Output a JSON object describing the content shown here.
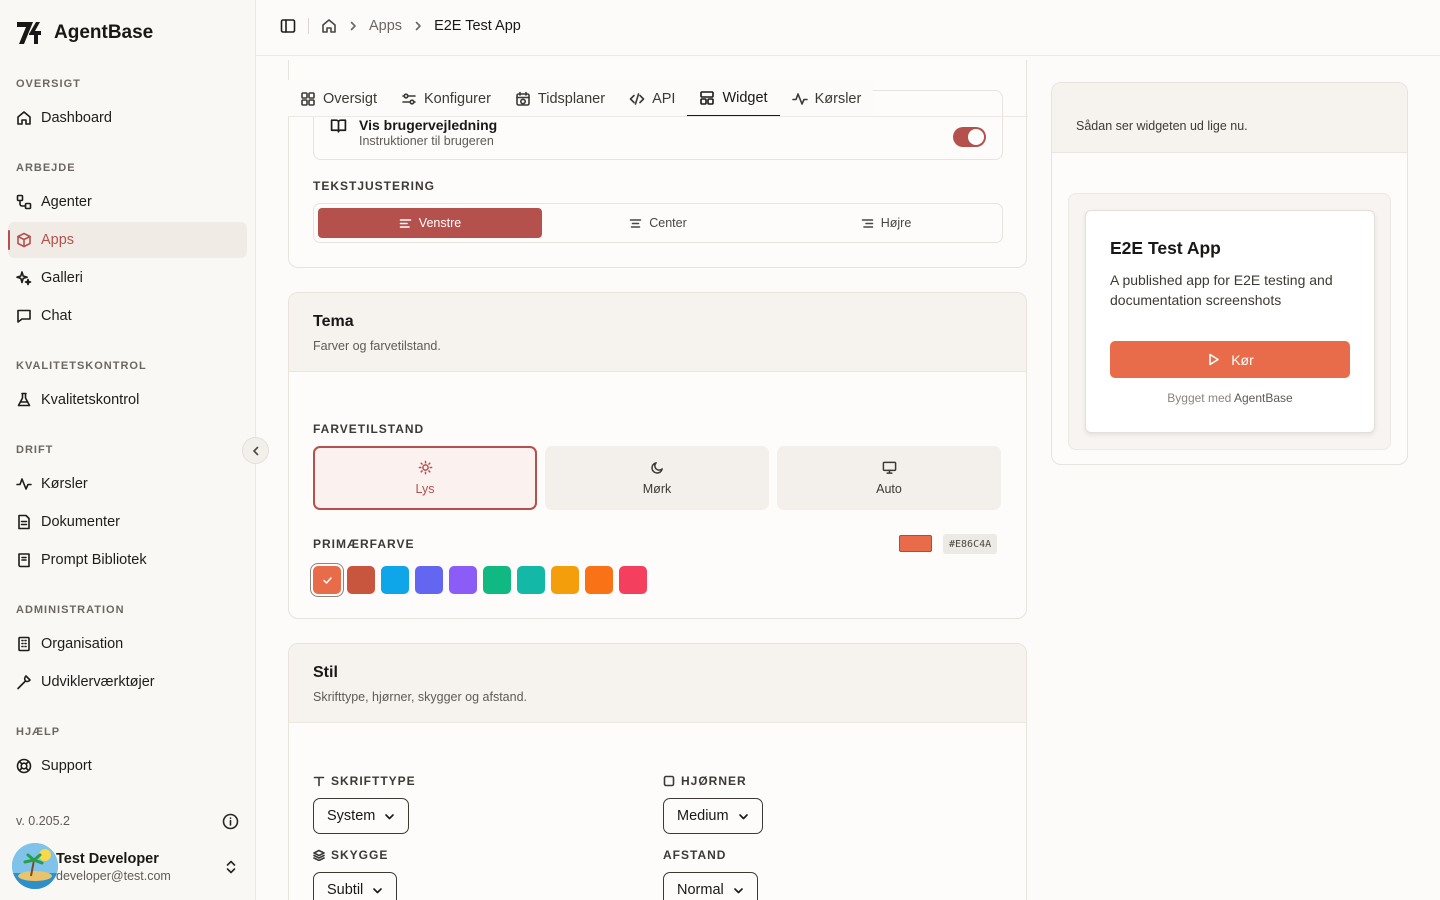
{
  "app": {
    "name": "AgentBase"
  },
  "sidebar": {
    "sections": [
      {
        "title": "OVERSIGT",
        "items": [
          {
            "label": "Dashboard",
            "icon": "home-icon"
          }
        ]
      },
      {
        "title": "ARBEJDE",
        "items": [
          {
            "label": "Agenter",
            "icon": "workflow-icon"
          },
          {
            "label": "Apps",
            "icon": "box-icon",
            "active": true
          },
          {
            "label": "Galleri",
            "icon": "sparkles-icon"
          },
          {
            "label": "Chat",
            "icon": "chat-icon"
          }
        ]
      },
      {
        "title": "KVALITETSKONTROL",
        "items": [
          {
            "label": "Kvalitetskontrol",
            "icon": "flask-icon"
          }
        ]
      },
      {
        "title": "DRIFT",
        "items": [
          {
            "label": "Kørsler",
            "icon": "activity-icon"
          },
          {
            "label": "Dokumenter",
            "icon": "document-icon"
          },
          {
            "label": "Prompt Bibliotek",
            "icon": "book-icon"
          }
        ]
      },
      {
        "title": "ADMINISTRATION",
        "items": [
          {
            "label": "Organisation",
            "icon": "building-icon"
          },
          {
            "label": "Udviklerværktøjer",
            "icon": "wrench-icon"
          }
        ]
      },
      {
        "title": "HJÆLP",
        "items": [
          {
            "label": "Support",
            "icon": "lifebuoy-icon"
          }
        ]
      }
    ],
    "version": "v. 0.205.2",
    "user": {
      "name": "Test Developer",
      "email": "developer@test.com"
    }
  },
  "header": {
    "breadcrumbs": [
      "Apps",
      "E2E Test App"
    ]
  },
  "tabs": [
    {
      "label": "Oversigt",
      "icon": "grid-icon"
    },
    {
      "label": "Konfigurer",
      "icon": "sliders-icon"
    },
    {
      "label": "Tidsplaner",
      "icon": "calendar-clock-icon"
    },
    {
      "label": "API",
      "icon": "code-icon"
    },
    {
      "label": "Widget",
      "icon": "layout-icon",
      "active": true
    },
    {
      "label": "Kørsler",
      "icon": "activity-icon"
    }
  ],
  "settings": {
    "guide": {
      "title": "Vis brugervejledning",
      "subtitle": "Instruktioner til brugeren",
      "enabled": true
    },
    "alignment": {
      "label": "TEKSTJUSTERING",
      "options": [
        "Venstre",
        "Center",
        "Højre"
      ],
      "selected": "Venstre"
    },
    "theme": {
      "title": "Tema",
      "subtitle": "Farver og farvetilstand.",
      "mode_label": "FARVETILSTAND",
      "modes": [
        "Lys",
        "Mørk",
        "Auto"
      ],
      "selected_mode": "Lys",
      "primary_label": "PRIMÆRFARVE",
      "primary_hex": "#E86C4A",
      "swatches": [
        "#E86C4A",
        "#C8553D",
        "#0EA5E9",
        "#6366F1",
        "#8B5CF6",
        "#10B981",
        "#14B8A6",
        "#F59E0B",
        "#F97316",
        "#F43F5E"
      ]
    },
    "style": {
      "title": "Stil",
      "subtitle": "Skrifttype, hjørner, skygger og afstand.",
      "font_label": "SKRIFTTYPE",
      "font_value": "System",
      "corners_label": "HJØRNER",
      "corners_value": "Medium",
      "shadow_label": "SKYGGE",
      "shadow_value": "Subtil",
      "spacing_label": "AFSTAND",
      "spacing_value": "Normal"
    }
  },
  "preview": {
    "subtitle": "Sådan ser widgeten ud lige nu.",
    "widget_title": "E2E Test App",
    "widget_desc": "A published app for E2E testing and documentation screenshots",
    "run_label": "Kør",
    "built_prefix": "Bygget med",
    "built_brand": "AgentBase"
  },
  "colors": {
    "accent": "#B4514D",
    "primary": "#E86C4A"
  }
}
